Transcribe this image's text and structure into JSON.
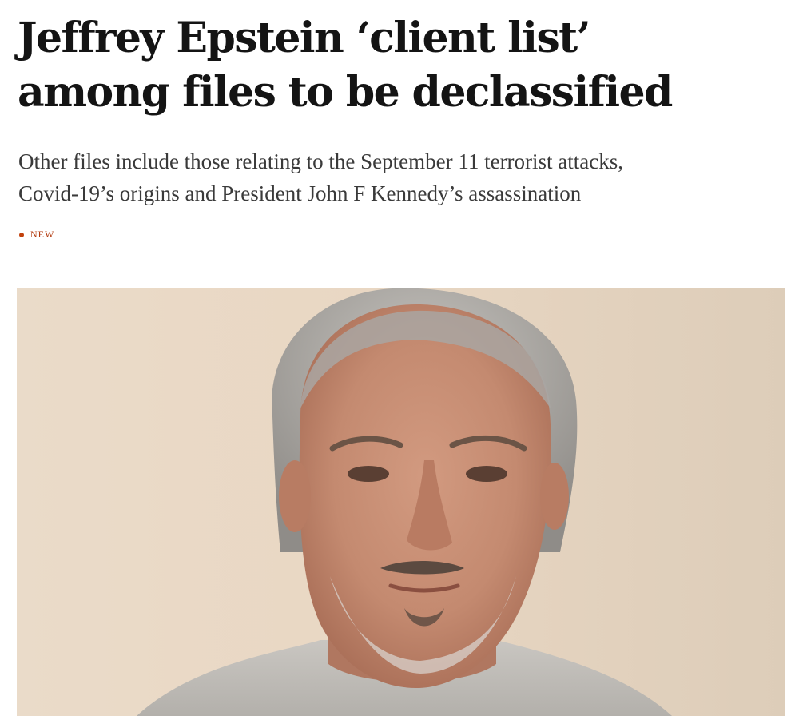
{
  "article": {
    "headline_lines": [
      "Jeffrey Epstein ‘client list’",
      "among files to be declassified"
    ],
    "standfirst_lines": [
      "Other files include those relating to the September 11 terrorist attacks,",
      "Covid-19’s origins and President John F Kennedy’s assassination"
    ],
    "badge": "NEW",
    "badge_color": "#c2410c"
  }
}
